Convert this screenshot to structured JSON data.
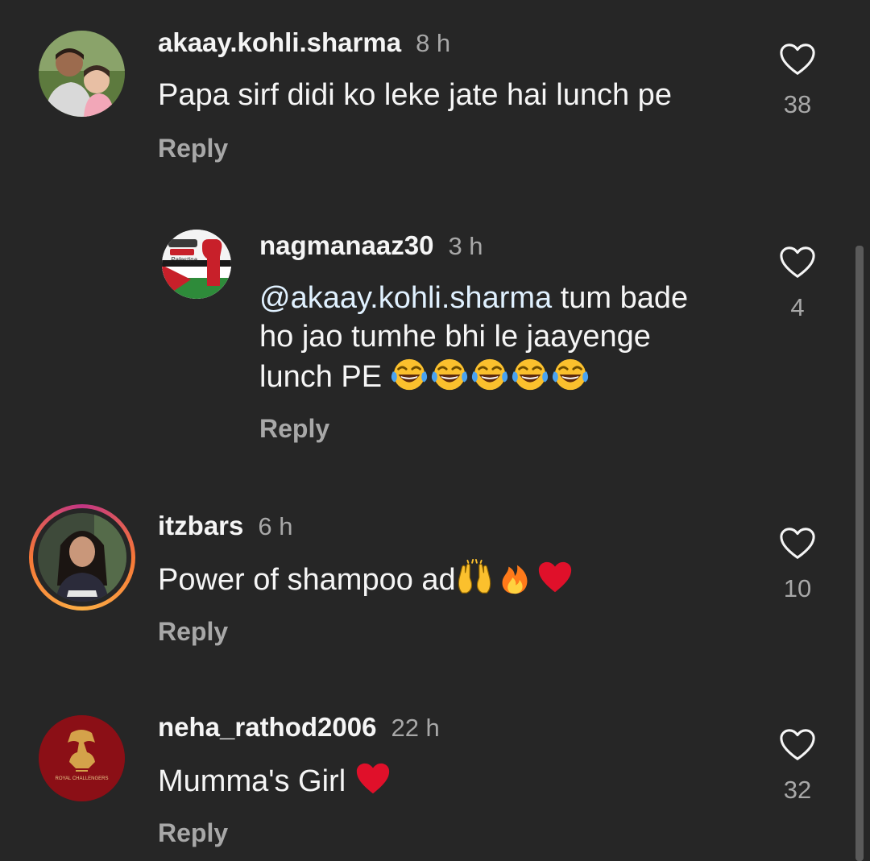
{
  "comments": [
    {
      "username": "akaay.kohli.sharma",
      "time": "8 h",
      "text": "Papa sirf didi ko leke jate hai lunch pe",
      "reply_label": "Reply",
      "likes": "38",
      "avatar_icon": "profile-photo-man-with-child"
    },
    {
      "username": "nagmanaaz30",
      "time": "3 h",
      "mention": "@akaay.kohli.sharma",
      "text_line1_rest": " tum bade",
      "text_line2": "ho jao tumhe bhi le jaayenge",
      "text_line3": "lunch PE ",
      "reply_label": "Reply",
      "likes": "4",
      "avatar_icon": "palestine-fist-logo",
      "avatar_caption": "Palestina",
      "emoji_icon": "tears-of-joy-emoji"
    },
    {
      "username": "itzbars",
      "time": "6 h",
      "text": "Power of shampoo ad",
      "reply_label": "Reply",
      "likes": "10",
      "avatar_icon": "profile-photo-girl",
      "emoji_icons": [
        "raising-hands-emoji",
        "fire-emoji",
        "red-heart-emoji"
      ]
    },
    {
      "username": "neha_rathod2006",
      "time": "22 h",
      "text": "Mumma's Girl ",
      "reply_label": "Reply",
      "likes": "32",
      "avatar_icon": "rcb-crest-logo",
      "avatar_caption": "ROYAL CHALLENGERS",
      "emoji_icons": [
        "red-heart-emoji"
      ]
    }
  ],
  "colors": {
    "background": "#262626",
    "text": "#f5f5f5",
    "muted": "#a8a8a8",
    "story_ring_start": "#f77737",
    "story_ring_end": "#c13584",
    "heart_emoji": "#e0102a"
  }
}
